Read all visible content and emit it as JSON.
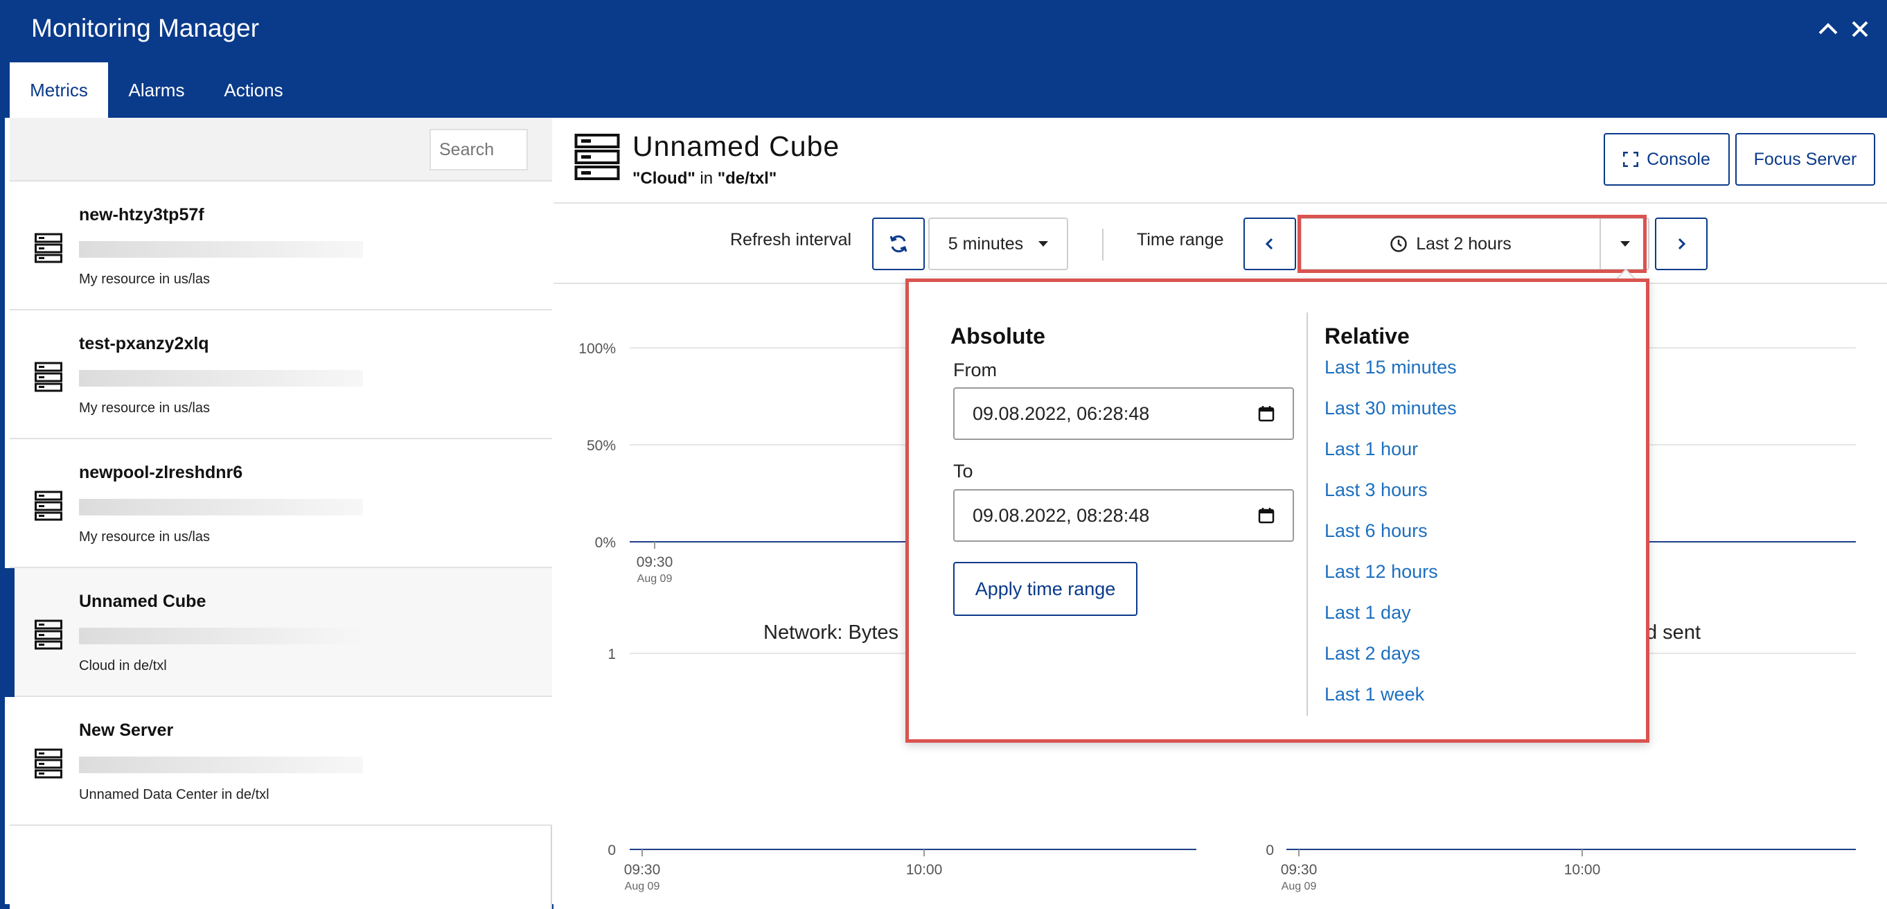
{
  "window": {
    "title": "Monitoring Manager"
  },
  "tabs": [
    {
      "label": "Metrics",
      "active": true
    },
    {
      "label": "Alarms",
      "active": false
    },
    {
      "label": "Actions",
      "active": false
    }
  ],
  "sidebar": {
    "search_placeholder": "Search",
    "items": [
      {
        "name": "new-htzy3tp57f",
        "desc": "My resource in us/las",
        "icon": "server-icon"
      },
      {
        "name": "test-pxanzy2xlq",
        "desc": "My resource in us/las",
        "icon": "server-icon"
      },
      {
        "name": "newpool-zlreshdnr6",
        "desc": "My resource in us/las",
        "icon": "server-icon"
      },
      {
        "name": "Unnamed Cube",
        "desc": "Cloud in de/txl",
        "icon": "server-icon",
        "selected": true
      },
      {
        "name": "New Server",
        "desc": "Unnamed Data Center in de/txl",
        "icon": "server-icon"
      }
    ]
  },
  "main": {
    "title": "Unnamed Cube",
    "subtitle_dc": "\"Cloud\"",
    "subtitle_in": " in ",
    "subtitle_loc": "\"de/txl\"",
    "console_label": "Console",
    "focus_label": "Focus Server"
  },
  "toolbar": {
    "refresh_label": "Refresh interval",
    "interval_value": "5 minutes",
    "time_range_label": "Time range",
    "range_value": "Last 2 hours"
  },
  "popup": {
    "absolute_title": "Absolute",
    "from_label": "From",
    "from_value": "09.08.2022, 06:28:48",
    "to_label": "To",
    "to_value": "09.08.2022, 08:28:48",
    "apply_label": "Apply time range",
    "relative_title": "Relative",
    "relative_options": [
      "Last 15 minutes",
      "Last 30 minutes",
      "Last 1 hour",
      "Last 3 hours",
      "Last 6 hours",
      "Last 12 hours",
      "Last 1 day",
      "Last 2 days",
      "Last 1 week"
    ]
  },
  "charts": {
    "top": {
      "y_ticks": [
        "100%",
        "50%",
        "0%"
      ],
      "x_tick": "09:30",
      "x_tick_sub": "Aug 09"
    },
    "bottom_left": {
      "title_visible": "Network: Bytes",
      "y_ticks": [
        "1",
        "0"
      ],
      "x_ticks": [
        "09:30",
        "10:00"
      ],
      "x_tick_sub": "Aug 09"
    },
    "bottom_right": {
      "title_visible": "d sent",
      "y_ticks": [
        "0"
      ],
      "x_ticks": [
        "09:30",
        "10:00"
      ],
      "x_tick_sub": "Aug 09"
    }
  },
  "colors": {
    "brand": "#0a3a8a",
    "link": "#1c6fbf",
    "highlight": "#d9534f"
  }
}
